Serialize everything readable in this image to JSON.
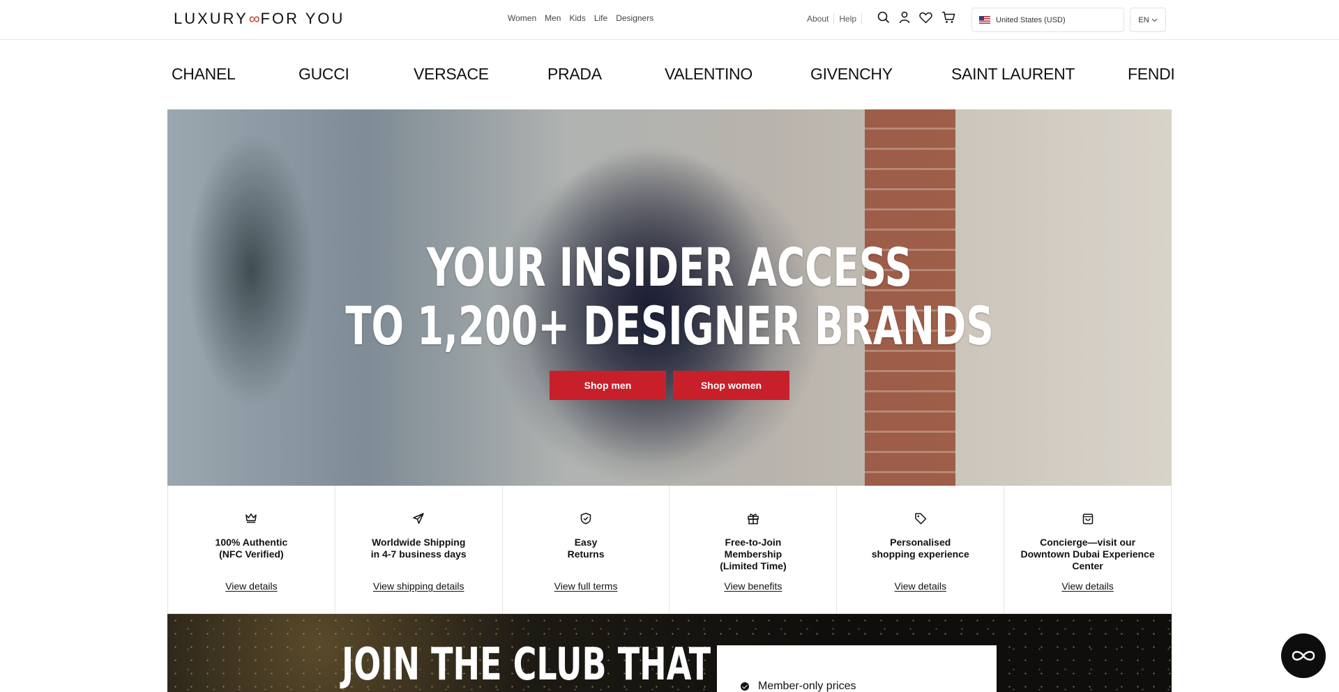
{
  "header": {
    "logo_left": "LUXURY",
    "logo_symbol": "∞",
    "logo_right": "FOR YOU",
    "nav": [
      "Women",
      "Men",
      "Kids",
      "Life",
      "Designers"
    ],
    "util": [
      "About",
      "Help"
    ],
    "icons": [
      "search-icon",
      "account-icon",
      "wishlist-icon",
      "cart-icon"
    ],
    "country": "United States  (USD)",
    "language": "EN"
  },
  "brands": [
    "CHANEL",
    "GUCCI",
    "VERSACE",
    "PRADA",
    "VALENTINO",
    "GIVENCHY",
    "SAINT LAURENT",
    "FENDI"
  ],
  "hero": {
    "title_line1": "YOUR INSIDER ACCESS",
    "title_line2": "TO 1,200+ DESIGNER BRANDS",
    "btn_men": "Shop men",
    "btn_women": "Shop women",
    "accent": "#c8202b"
  },
  "features": [
    {
      "icon": "crown-icon",
      "text": "100% Authentic\n(NFC Verified)",
      "link": "View details"
    },
    {
      "icon": "plane-icon",
      "text": "Worldwide Shipping\nin 4-7 business days",
      "link": "View shipping details"
    },
    {
      "icon": "shield-icon",
      "text": "Easy\nReturns",
      "link": "View full terms"
    },
    {
      "icon": "gift-icon",
      "text": "Free-to-Join\nMembership\n(Limited Time)",
      "link": "View benefits"
    },
    {
      "icon": "tag-icon",
      "text": "Personalised\nshopping experience",
      "link": "View details"
    },
    {
      "icon": "bag-icon",
      "text": "Concierge—visit our\nDowntown Dubai Experience\nCenter",
      "link": "View details"
    }
  ],
  "club": {
    "title": "JOIN THE CLUB THAT",
    "item": "Member-only prices"
  },
  "chat": {
    "icon": "chat-infinity-icon"
  }
}
